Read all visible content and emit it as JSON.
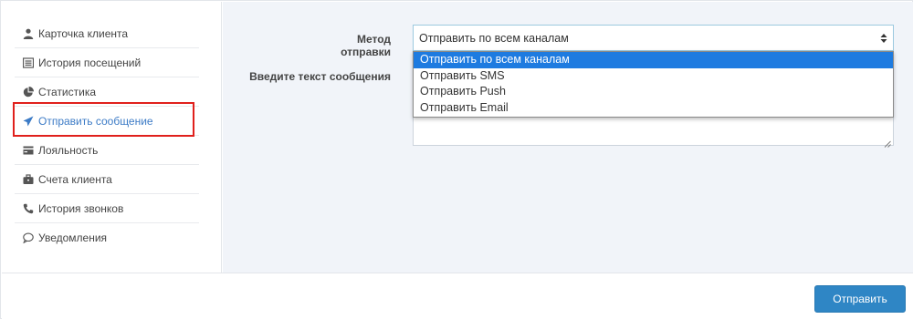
{
  "sidebar": {
    "items": [
      {
        "label": "Карточка клиента",
        "icon": "user-icon"
      },
      {
        "label": "История посещений",
        "icon": "list-icon"
      },
      {
        "label": "Статистика",
        "icon": "pie-chart-icon"
      },
      {
        "label": "Отправить сообщение",
        "icon": "paper-plane-icon",
        "active": true
      },
      {
        "label": "Лояльность",
        "icon": "credit-card-icon"
      },
      {
        "label": "Счета клиента",
        "icon": "briefcase-icon"
      },
      {
        "label": "История звонков",
        "icon": "phone-icon"
      },
      {
        "label": "Уведомления",
        "icon": "speech-bubble-icon"
      }
    ]
  },
  "form": {
    "method_label": "Метод отправки",
    "method_value": "Отправить по всем каналам",
    "method_options": [
      "Отправить по всем каналам",
      "Отправить SMS",
      "Отправить Push",
      "Отправить Email"
    ],
    "text_label": "Введите текст сообщения",
    "text_value": ""
  },
  "footer": {
    "send_label": "Отправить"
  },
  "colors": {
    "accent": "#2f86c5",
    "active_link": "#3c7bc6",
    "highlight": "#e0201c",
    "selected_option": "#1e7be0",
    "panel_bg": "#f1f4f9"
  }
}
